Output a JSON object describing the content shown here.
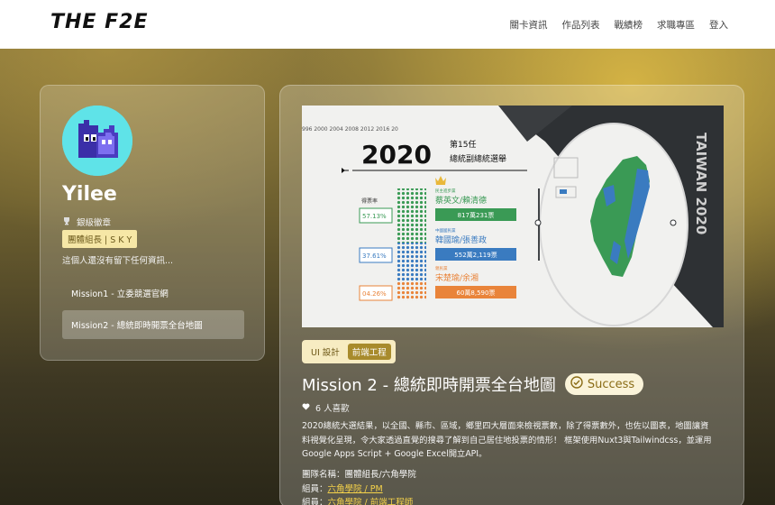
{
  "brand": {
    "logo": "THE F2E"
  },
  "nav": {
    "items": [
      "關卡資訊",
      "作品列表",
      "戰績榜",
      "求職專區",
      "登入"
    ]
  },
  "profile": {
    "name": "Yilee",
    "badge": "銀級徽章",
    "role": "團體組長 | S K Y",
    "bio": "這個人還沒有留下任何資訊...",
    "missions": [
      "Mission1 - 立委競選官網",
      "Mission2 - 總統即時開票全台地圖"
    ]
  },
  "cover": {
    "years": "996  2000  2004  2008  2012  2016  20",
    "year_big": "2020",
    "term": "第15任",
    "subtitle": "總統副總統選舉",
    "label_rate": "得票率",
    "side_text": "TAIWAN 2020",
    "candidates": [
      {
        "party": "民主進步黨",
        "names": "蔡英文/賴清德",
        "votes": "817萬231票",
        "rate": "57.13%",
        "color": "#3a9a55"
      },
      {
        "party": "中國國民黨",
        "names": "韓國瑜/張善政",
        "votes": "552萬2,119票",
        "rate": "37.61%",
        "color": "#3a7bc0"
      },
      {
        "party": "親民黨",
        "names": "宋楚瑜/余湘",
        "votes": "60萬8,590票",
        "rate": "04.26%",
        "color": "#e9843a"
      }
    ]
  },
  "project": {
    "tags": [
      "UI 設計",
      "前端工程"
    ],
    "title": "Mission 2 - 總統即時開票全台地圖",
    "status": "Success",
    "likes": "6 人喜歡",
    "description": [
      "2020總統大選結果，以全國、縣市、區域，鄉里四大層面來檢視票數，除了得票數外，也佐以圖表，地圖讓資",
      "料視覺化呈現，令大家透過直覺的搜尋了解到自己居住地投票的情形！ 框架使用Nuxt3與Tailwindcss，並運用",
      "Google Apps Script + Google Excel開立API。"
    ],
    "team_label": "團隊名稱：團體組長/六角學院",
    "members": [
      {
        "prefix": "組員：",
        "link": "六角學院 / PM"
      },
      {
        "prefix": "組員：",
        "link": "六角學院 / 前端工程師"
      }
    ]
  },
  "colors": {
    "accent": "#e2be46",
    "status": "#8a6c16"
  }
}
